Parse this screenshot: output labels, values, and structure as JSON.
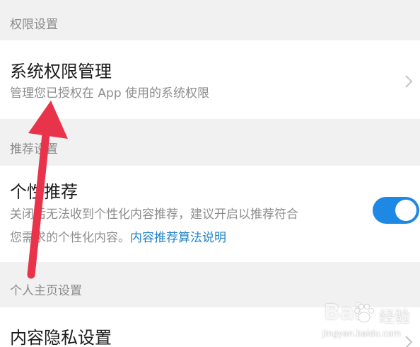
{
  "sections": {
    "permissions": {
      "header": "权限设置",
      "item": {
        "title": "系统权限管理",
        "description": "管理您已授权在 App 使用的系统权限"
      }
    },
    "recommendation": {
      "header": "推荐设置",
      "item": {
        "title": "个性推荐",
        "description_line1": "关闭后无法收到个性化内容推荐，建议开启以推荐符合",
        "description_line2": "您需求的个性化内容。",
        "link": "内容推荐算法说明",
        "toggle_on": true
      }
    },
    "profile": {
      "header": "个人主页设置",
      "item": {
        "title": "内容隐私设置"
      }
    }
  },
  "watermark": {
    "logo_left": "Bai",
    "logo_right": "经验",
    "url": "jingyan.baidu.com"
  },
  "colors": {
    "accent": "#1e88e5",
    "link": "#1e82c8",
    "annotation_arrow": "#e8334a"
  },
  "icons": [
    "chevron-right-icon",
    "toggle-switch",
    "paw-icon",
    "annotation-arrow"
  ]
}
